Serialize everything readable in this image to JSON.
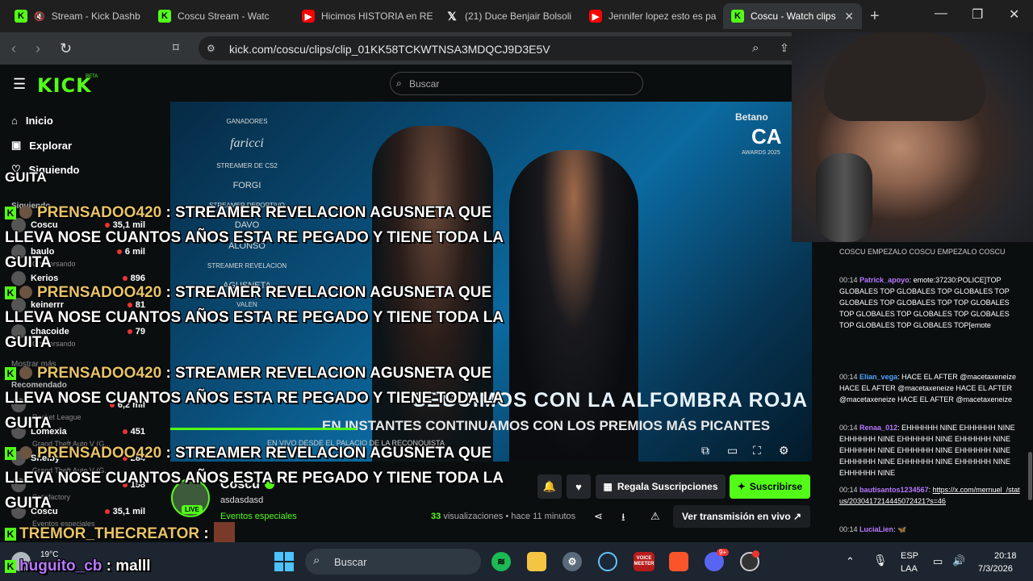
{
  "browser": {
    "tabs": [
      {
        "title": "Stream - Kick Dashb",
        "icon": "kick",
        "muted": true
      },
      {
        "title": "Coscu Stream - Watc",
        "icon": "kick"
      },
      {
        "title": "Hicimos HISTORIA en RE",
        "icon": "youtube"
      },
      {
        "title": "(21) Duce Benjair Bolsoli",
        "icon": "x"
      },
      {
        "title": "Jennifer lopez esto es pa",
        "icon": "youtube"
      },
      {
        "title": "Coscu - Watch clips",
        "icon": "kick",
        "active": true
      }
    ],
    "url": "kick.com/coscu/clips/clip_01KK58TCKWTNSA3MDQCJ9D3E5V",
    "brave_badge": "6"
  },
  "kick": {
    "logo": "KICK",
    "beta": "BETA",
    "search_placeholder": "Buscar",
    "nav": [
      {
        "label": "Inicio",
        "icon": "home-icon"
      },
      {
        "label": "Explorar",
        "icon": "compass-icon"
      },
      {
        "label": "Siguiendo",
        "icon": "heart-icon"
      }
    ],
    "sidebar": {
      "following_header": "Siguiendo",
      "following": [
        {
          "name": "Coscu",
          "count": "35,1 mil"
        },
        {
          "name": "baulo",
          "count": "6 mil",
          "sub": "Conversando"
        },
        {
          "name": "Kerios",
          "count": "896"
        },
        {
          "name": "keinerrr",
          "count": "81"
        },
        {
          "name": "chacoide",
          "count": "79",
          "sub": "Conversando"
        }
      ],
      "show_more": "Mostrar más",
      "recommended_header": "Recomendado",
      "recommended": [
        {
          "name": "Rocket League",
          "count": "6,2 mil"
        },
        {
          "name": "Lomexia",
          "count": "451",
          "sub": "Grand Theft Auto V (G..."
        },
        {
          "name": "Shelby",
          "count": "284",
          "sub": "Grand Theft Auto V (G..."
        },
        {
          "name": "Satisfactory",
          "count": "158"
        },
        {
          "name": "Coscu",
          "count": "35,1 mil",
          "sub": "Eventos especiales"
        }
      ]
    },
    "video": {
      "winners_header": "GANADORES",
      "winners": [
        "faricci",
        "STREAMER DE CS2",
        "FORGI",
        "STREAMER DEPORTIVO",
        "DAVO",
        "ALONSO",
        "STREAMER REVELACION",
        "AGUSNETA",
        "MELIAN",
        "VALEN"
      ],
      "sponsor": "Betano",
      "awards_logo": "CA",
      "awards_sub": "AWARDS 2025",
      "banner_main": "SEGUIMOS CON LA ALFOMBRA ROJA",
      "banner_sub": "EN INSTANTES CONTINUAMOS CON LOS PREMIOS MÁS PICANTES",
      "banner_small": "EN VIVO DESDE EL PALACIO DE LA RECONQUISTA",
      "progress": 0.29
    },
    "clip": {
      "channel": "Coscu",
      "title": "asdasdasd",
      "category": "Eventos especiales",
      "live_badge": "LIVE",
      "views_count": "33",
      "views_label": "visualizaciones",
      "time_ago": "hace 11 minutos",
      "gift_label": "Regala Suscripciones",
      "subscribe_label": "Suscribirse",
      "watch_live_label": "Ver transmisión en vivo"
    },
    "chat": [
      {
        "time": "",
        "user": "",
        "color": "",
        "text": "COSCU  EMPEZALO COSCU  EMPEZALO COSCU"
      },
      {
        "time": "00:14",
        "user": "Patrick_apoyo",
        "color": "#b878ff",
        "text": "emote:37230:POLICE]TOP GLOBALES  TOP GLOBALES  TOP GLOBALES  TOP GLOBALES  TOP GLOBALES  TOP  TOP GLOBALES  TOP GLOBALES  TOP GLOBALES  TOP GLOBALES  TOP GLOBALES  TOP GLOBALES  TOP[emote"
      },
      {
        "time": "00:14",
        "user": "Elian_vega",
        "color": "#4fa3ff",
        "text": "HACE EL AFTER @macetaxeneize  HACE EL AFTER @macetaxeneize  HACE EL AFTER @macetaxeneize  HACE EL AFTER @macetaxeneize"
      },
      {
        "time": "00:14",
        "user": "Renaa_012",
        "color": "#b878ff",
        "text": "EHHHHHH NINE EHHHHHH NINE EHHHHHH NINE EHHHHHH NINE EHHHHHH NINE EHHHHHH NINE EHHHHHH NINE EHHHHHH NINE EHHHHHH NINE EHHHHHH NINE EHHHHHH NINE EHHHHHH NINE"
      },
      {
        "time": "00:14",
        "user": "bautisantos1234567",
        "color": "#b878ff",
        "text": "https://x.com/mernuel_/status/2030417214445072421?s=46"
      },
      {
        "time": "00:14",
        "user": "LuciaLien",
        "color": "#b878ff",
        "text": ""
      }
    ]
  },
  "overlay": [
    {
      "user": "PRENSADOO420",
      "text": ": STREAMER REVELACION AGUSNETA QUE",
      "line2": "LLEVA NOSE CUANTOS AÑOS ESTA RE PEGADO Y TIENE TODA LA",
      "line3": "GUITA"
    },
    {
      "user": "PRENSADOO420",
      "text": ": STREAMER REVELACION AGUSNETA QUE",
      "line2": "LLEVA NOSE CUANTOS AÑOS ESTA RE PEGADO Y TIENE TODA LA",
      "line3": "GUITA"
    },
    {
      "user": "PRENSADOO420",
      "text": ": STREAMER REVELACION AGUSNETA QUE",
      "line2": "LLEVA NOSE CUANTOS AÑOS ESTA RE PEGADO Y TIENE TODA LA",
      "line3": "GUITA"
    },
    {
      "user": "PRENSADOO420",
      "text": ": STREAMER REVELACION AGUSNETA QUE",
      "line2": "LLEVA NOSE CUANTOS AÑOS ESTA RE PEGADO Y TIENE TODA LA",
      "line3": "GUITA"
    },
    {
      "user": "TREMOR_THECREATOR",
      "text": ":"
    },
    {
      "user": "huguito_cb",
      "text": ": malll"
    }
  ],
  "overlay_top_fragment": "GUITA",
  "taskbar": {
    "weather_temp": "19°C",
    "search_placeholder": "Buscar",
    "lang": "ESP",
    "lang2": "LAA",
    "time": "20:18",
    "date": "7/3/2026",
    "discord_badge": "9+",
    "voicemeeter": "VOICE MEETER"
  },
  "colors": {
    "kick_green": "#53fc18",
    "bg": "#0b0e0f"
  }
}
